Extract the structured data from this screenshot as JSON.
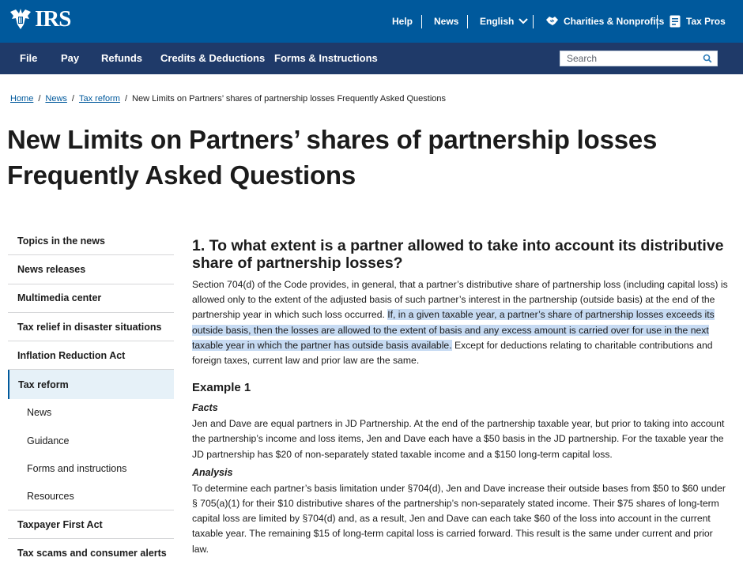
{
  "header": {
    "logo_text": "IRS",
    "utility": {
      "help": "Help",
      "news": "News",
      "language": "English",
      "charities": "Charities & Nonprofits",
      "tax_pros": "Tax Pros"
    }
  },
  "nav": {
    "items": [
      "File",
      "Pay",
      "Refunds",
      "Credits & Deductions",
      "Forms & Instructions"
    ],
    "search_placeholder": "Search"
  },
  "breadcrumb": {
    "home": "Home",
    "news": "News",
    "tax_reform": "Tax reform",
    "current": "New Limits on Partners’ shares of partnership losses Frequently Asked Questions"
  },
  "page_title": "New Limits on Partners’ shares of partnership losses Frequently Asked Questions",
  "sidebar": {
    "items": [
      {
        "label": "Topics in the news"
      },
      {
        "label": "News releases"
      },
      {
        "label": "Multimedia center"
      },
      {
        "label": "Tax relief in disaster situations"
      },
      {
        "label": "Inflation Reduction Act"
      },
      {
        "label": "Tax reform"
      },
      {
        "label": "News"
      },
      {
        "label": "Guidance"
      },
      {
        "label": "Forms and instructions"
      },
      {
        "label": "Resources"
      },
      {
        "label": "Taxpayer First Act"
      },
      {
        "label": "Tax scams and consumer alerts"
      }
    ]
  },
  "content": {
    "question": "1. To what extent is a partner allowed to take into account its distributive share of partnership losses?",
    "answer_before": "Section 704(d) of the Code provides, in general, that a partner’s distributive share of partnership loss (including capital loss) is allowed only to the extent of the adjusted basis of such partner’s interest in the partnership (outside basis) at the end of the partnership year in which such loss occurred. ",
    "answer_highlight": "If, in a given taxable year, a partner’s share of partnership losses exceeds its outside basis, then the losses are allowed to the extent of basis and any excess amount is carried over for use in the next taxable year in which the partner has outside basis available.",
    "answer_after": " Except for deductions relating to charitable contributions and foreign taxes, current law and prior law are the same.",
    "example_heading": "Example 1",
    "facts_label": "Facts",
    "facts_text": "Jen and Dave are equal partners in JD Partnership.  At the end of the partnership taxable year, but prior to taking into account the partnership’s income and loss items, Jen and Dave each have a $50 basis in the JD partnership.  For the taxable year the JD partnership has $20 of non-separately stated taxable income and a $150 long-term capital loss.",
    "analysis_label": "Analysis",
    "analysis_text": "To determine each partner’s basis limitation under §704(d), Jen and Dave increase their outside bases from $50 to $60 under § 705(a)(1) for their $10 distributive shares of the partnership’s non-separately stated income.  Their $75 shares of long-term capital loss are limited by §704(d) and, as a result, Jen and Dave can each take $60 of the loss into account in the current taxable year.  The remaining $15 of long-term capital loss is carried forward. This result is the same under current and prior law."
  },
  "colors": {
    "header_blue": "#00599c",
    "nav_navy": "#1f3a69",
    "highlight": "#c7dbf3",
    "active_bg": "#e6f1f8"
  }
}
